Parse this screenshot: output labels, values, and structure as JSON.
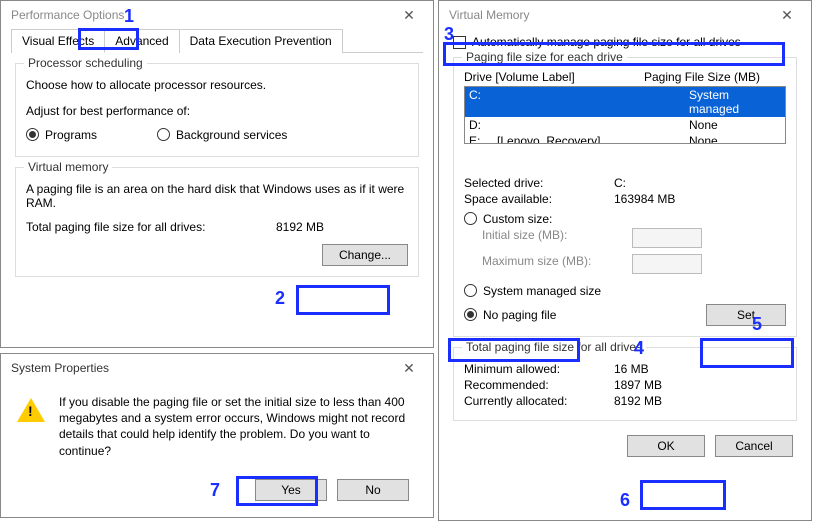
{
  "perf": {
    "title": "Performance Options",
    "tabs": {
      "visual": "Visual Effects",
      "advanced": "Advanced",
      "dep": "Data Execution Prevention"
    },
    "proc_sched_title": "Processor scheduling",
    "proc_sched_desc": "Choose how to allocate processor resources.",
    "adjust_label": "Adjust for best performance of:",
    "opt_programs": "Programs",
    "opt_bg": "Background services",
    "vm_title": "Virtual memory",
    "vm_desc": "A paging file is an area on the hard disk that Windows uses as if it were RAM.",
    "vm_total_label": "Total paging file size for all drives:",
    "vm_total_value": "8192 MB",
    "change_btn": "Change..."
  },
  "vm": {
    "title": "Virtual Memory",
    "auto_label": "Automatically manage paging file size for all drives",
    "group1_title": "Paging file size for each drive",
    "header_drive": "Drive  [Volume Label]",
    "header_size": "Paging File Size (MB)",
    "drives": [
      {
        "drive": "C:",
        "label": "",
        "size": "System managed"
      },
      {
        "drive": "D:",
        "label": "",
        "size": "None"
      },
      {
        "drive": "E:",
        "label": "[Lenovo_Recovery]",
        "size": "None"
      }
    ],
    "selected_drive_label": "Selected drive:",
    "selected_drive_value": "C:",
    "space_label": "Space available:",
    "space_value": "163984 MB",
    "opt_custom": "Custom size:",
    "initial_label": "Initial size (MB):",
    "max_label": "Maximum size (MB):",
    "opt_sysman": "System managed size",
    "opt_nopage": "No paging file",
    "set_btn": "Set",
    "group2_title": "Total paging file size for all drives",
    "min_label": "Minimum allowed:",
    "min_value": "16 MB",
    "rec_label": "Recommended:",
    "rec_value": "1897 MB",
    "cur_label": "Currently allocated:",
    "cur_value": "8192 MB",
    "ok_btn": "OK",
    "cancel_btn": "Cancel"
  },
  "sysprop": {
    "title": "System Properties",
    "message": "If you disable the paging file or set the initial size to less than 400 megabytes and a system error occurs, Windows might not record details that could help identify the problem. Do you want to continue?",
    "yes_btn": "Yes",
    "no_btn": "No"
  },
  "markers": {
    "m1": "1",
    "m2": "2",
    "m3": "3",
    "m4": "4",
    "m5": "5",
    "m6": "6",
    "m7": "7"
  }
}
